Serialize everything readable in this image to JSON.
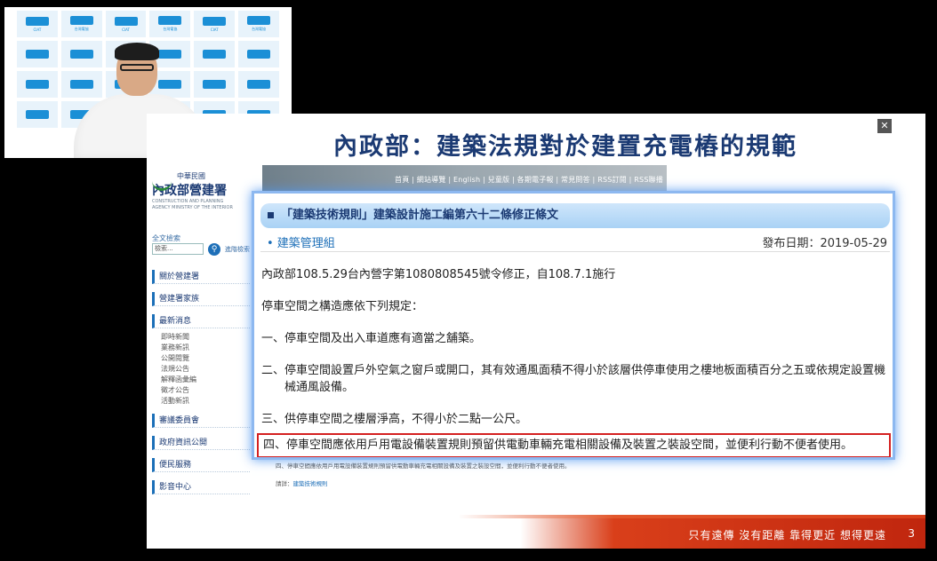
{
  "camera": {
    "wall_logo_text": "CIAT",
    "wall_logo_sub": "台灣電協"
  },
  "slide": {
    "title": "內政部：建築法規對於建置充電樁的規範",
    "close_glyph": "✕",
    "slogan": "只有遠傳  沒有距離  靠得更近  想得更遠",
    "page_number": "3"
  },
  "site": {
    "logo_line1": "中華民國",
    "logo_line2": "內政部營建署",
    "logo_line3a": "CONSTRUCTION AND PLANNING",
    "logo_line3b": "AGENCY MINISTRY OF THE INTERIOR",
    "top_nav": "首頁 | 網站導覽 | English | 兒童版 | 各期電子報 | 常見問答 | RSS訂閱 | RSS聯播",
    "search_label": "全文檢索",
    "search_placeholder": "檢索...",
    "search_adv": "進階檢索",
    "nav": [
      {
        "label": "關於營建署"
      },
      {
        "label": "營建署家族"
      },
      {
        "label": "最新消息",
        "subs": [
          "即時新聞",
          "業務新訊",
          "公開閱覽",
          "法規公告",
          "解釋函彙編",
          "徵才公告",
          "活動新訊"
        ]
      },
      {
        "label": "審議委員會"
      },
      {
        "label": "政府資訊公開"
      },
      {
        "label": "便民服務"
      },
      {
        "label": "影音中心"
      }
    ],
    "bottom_line": "四、停車空間應依用戶用電設備裝置規則預留供電動車輛充電相關設備及裝置之裝設空間，並便利行動不便者使用。",
    "ref_label": "請詳：",
    "ref_link": "建築技術規則"
  },
  "popup": {
    "heading": "「建築技術規則」建築設計施工編第六十二條修正條文",
    "sub": "• 建築管理組",
    "date": "發布日期：2019-05-29",
    "lines": [
      "內政部108.5.29台內營字第1080808545號令修正，自108.7.1施行",
      "停車空間之構造應依下列規定：",
      "一、停車空間及出入車道應有適當之舖築。",
      "二、停車空間設置戶外空氣之窗戶或開口，其有效通風面積不得小於該層供停車使用之樓地板面積百分之五或依規定設置機械通風設備。",
      "三、供停車空間之樓層淨高，不得小於二點一公尺。"
    ],
    "highlight": "四、停車空間應依用戶用電設備裝置規則預留供電動車輛充電相關設備及裝置之裝設空間，並便利行動不便者使用。"
  },
  "colors": {
    "title": "#1b3a73",
    "highlight_border": "#d42020",
    "footer": "#d93f1a"
  }
}
